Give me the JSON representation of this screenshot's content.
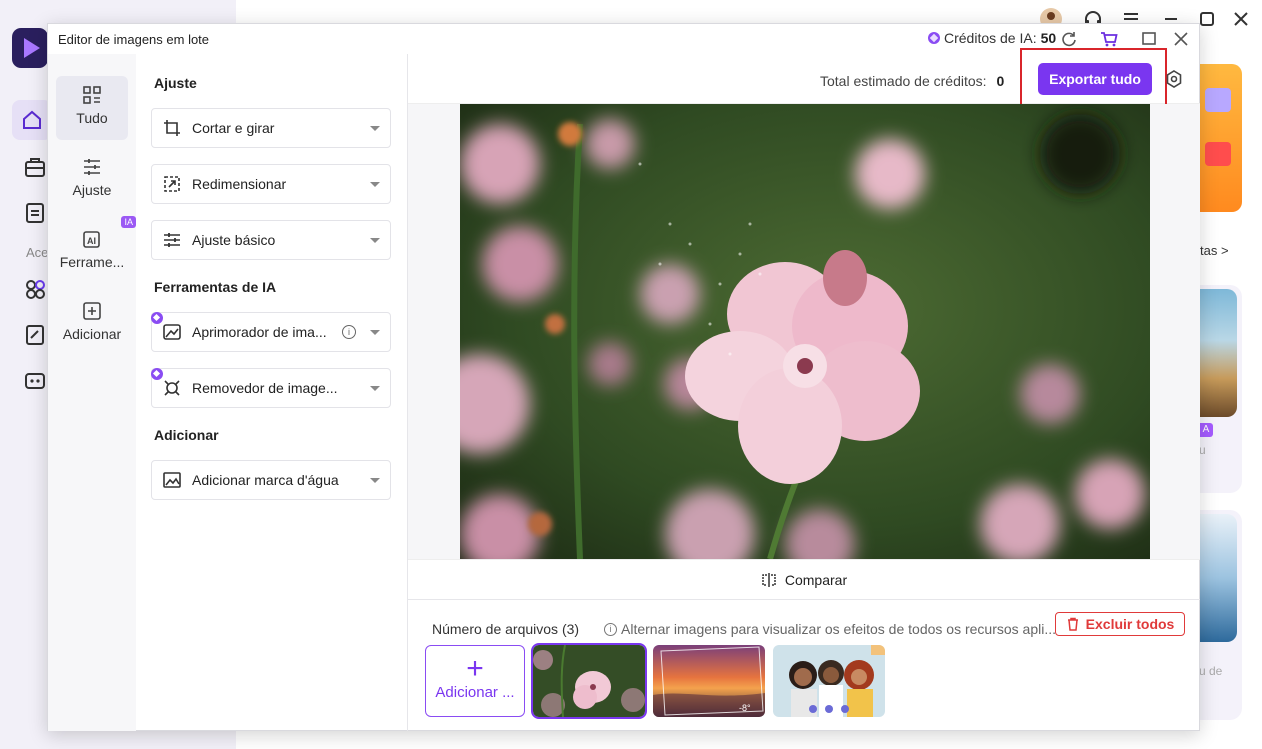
{
  "dialog": {
    "title": "Editor de imagens em lote",
    "credits_label": "Créditos de IA:",
    "credits_value": "50"
  },
  "categories": [
    {
      "label": "Tudo",
      "icon": "grid-icon",
      "active": true
    },
    {
      "label": "Ajuste",
      "icon": "sliders-icon"
    },
    {
      "label": "Ferrame...",
      "icon": "ai-tools-icon",
      "badge": "IA"
    },
    {
      "label": "Adicionar",
      "icon": "add-box-icon"
    }
  ],
  "tools": {
    "section_adjust": "Ajuste",
    "crop": "Cortar e girar",
    "resize": "Redimensionar",
    "basic": "Ajuste básico",
    "section_ai": "Ferramentas de IA",
    "enhancer": "Aprimorador de ima...",
    "remover": "Removedor de image...",
    "section_add": "Adicionar",
    "watermark": "Adicionar marca d'água"
  },
  "toolbar": {
    "estimate_label": "Total estimado de créditos:",
    "estimate_value": "0",
    "export_label": "Exportar tudo"
  },
  "compare_label": "Comparar",
  "files": {
    "count_label": "Número de arquivos (3)",
    "hint": "Alternar imagens para visualizar os efeitos de todos os recursos apli...",
    "delete_all": "Excluir todos",
    "add_label": "Adicionar ...",
    "rotation_badge": "-8°"
  },
  "background": {
    "sidebar_text": "Ace",
    "link_text": "tas >",
    "card2_tag": "A",
    "card2_text": "u",
    "card3_text": "u de"
  },
  "colors": {
    "accent": "#7a36f0",
    "danger": "#e03a3a",
    "highlight": "#d9252b"
  }
}
